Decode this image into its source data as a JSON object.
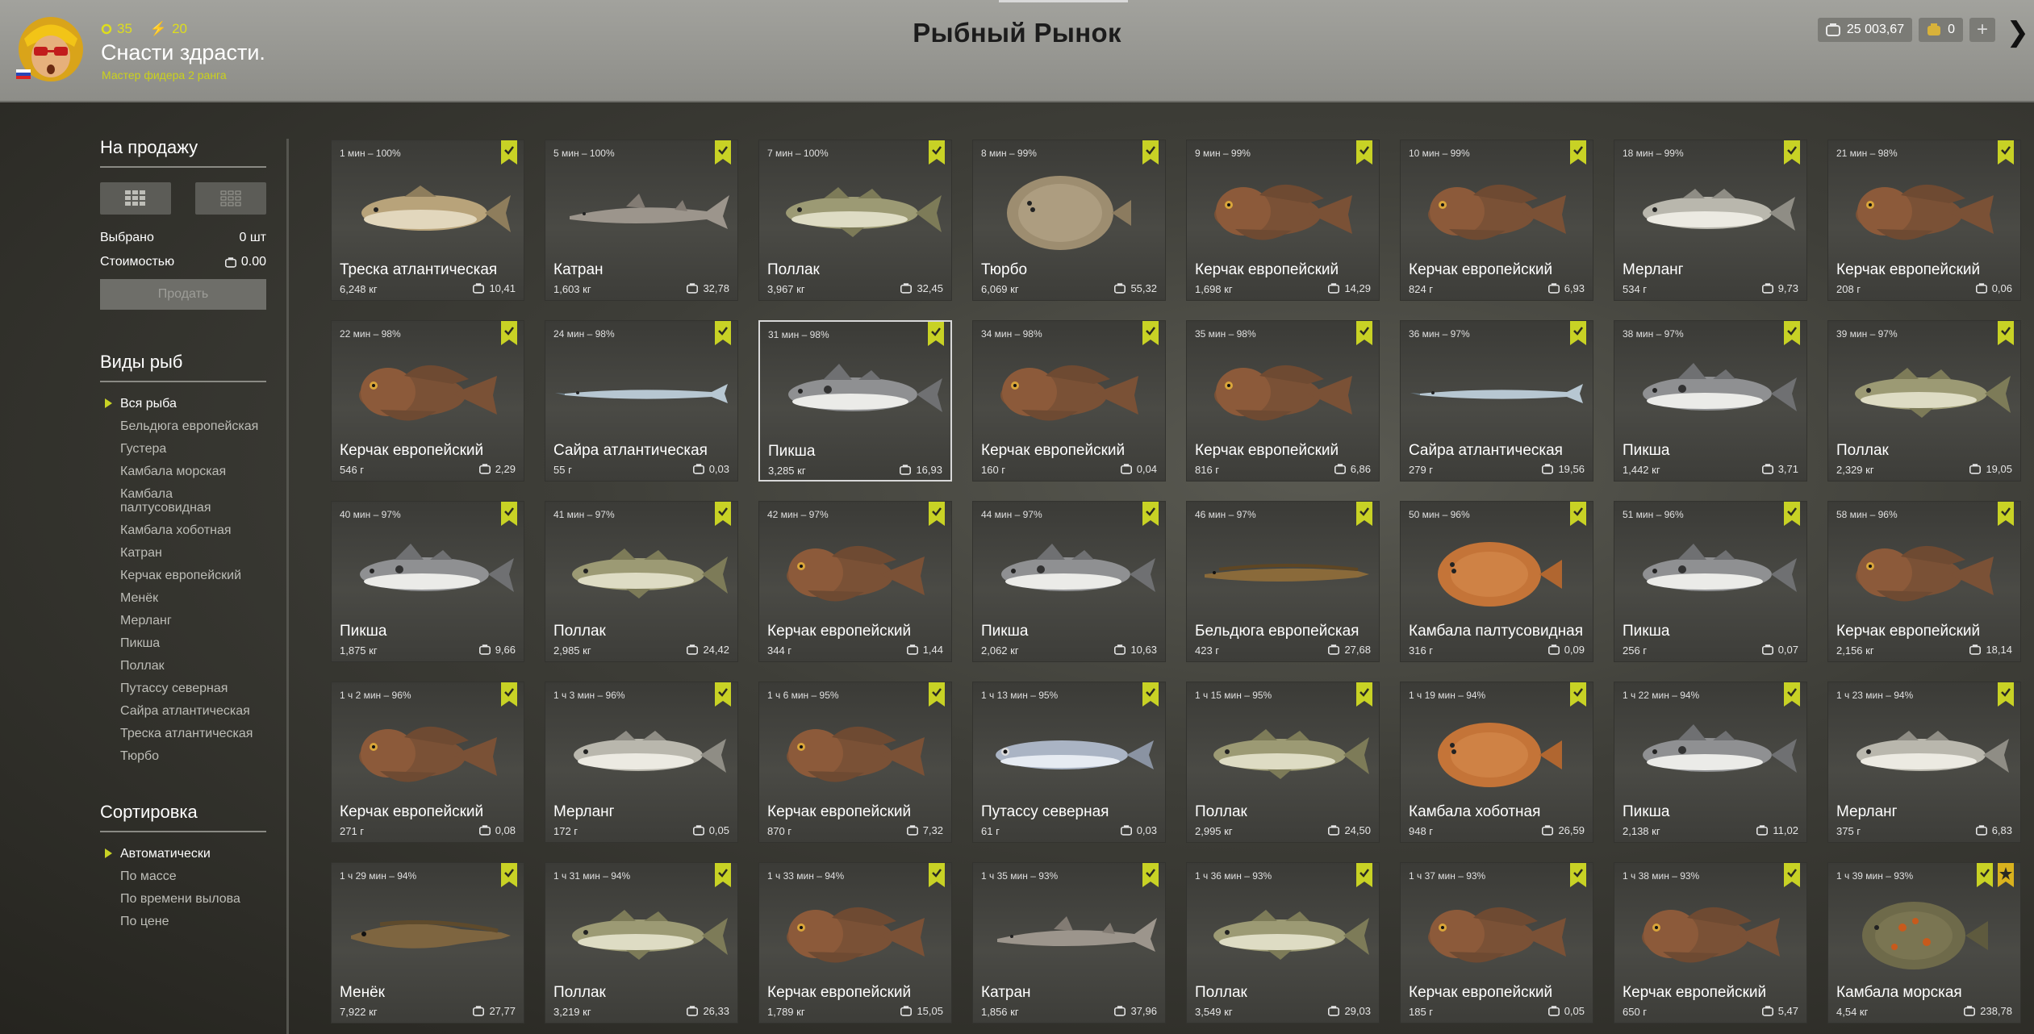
{
  "header": {
    "title": "Рыбный Рынок",
    "player_name": "Снасти здрасти.",
    "player_rank": "Мастер фидера 2 ранга",
    "level": "35",
    "stars": "20",
    "money": "25 003,67",
    "gold": "0",
    "plus": "+",
    "close": "❯"
  },
  "sidebar": {
    "sale_title": "На продажу",
    "selected_label": "Выбрано",
    "selected_value": "0 шт",
    "cost_label": "Стоимостью",
    "cost_value": "0.00",
    "sell_button": "Продать",
    "species_title": "Виды рыб",
    "species": [
      "Вся рыба",
      "Бельдюга европейская",
      "Густера",
      "Камбала морская",
      "Камбала палтусовидная",
      "Камбала хоботная",
      "Катран",
      "Керчак европейский",
      "Менёк",
      "Мерланг",
      "Пикша",
      "Поллак",
      "Путассу северная",
      "Сайра атлантическая",
      "Треска атлантическая",
      "Тюрбо"
    ],
    "sort_title": "Сортировка",
    "sort_options": [
      "Автоматически",
      "По массе",
      "По времени вылова",
      "По цене"
    ]
  },
  "colors": {
    "accent_lime": "#c8d225",
    "header_bg": "#9a9a95",
    "card_bg": "#42423d"
  },
  "fish": [
    {
      "time": "1 мин – 100%",
      "name": "Треска атлантическая",
      "weight": "6,248 кг",
      "price": "10,41",
      "kind": "cod",
      "badge": "check"
    },
    {
      "time": "5 мин – 100%",
      "name": "Катран",
      "weight": "1,603 кг",
      "price": "32,78",
      "kind": "shark",
      "badge": "check"
    },
    {
      "time": "7 мин – 100%",
      "name": "Поллак",
      "weight": "3,967 кг",
      "price": "32,45",
      "kind": "pollock",
      "badge": "check"
    },
    {
      "time": "8 мин – 99%",
      "name": "Тюрбо",
      "weight": "6,069 кг",
      "price": "55,32",
      "kind": "turbot",
      "badge": "check"
    },
    {
      "time": "9 мин – 99%",
      "name": "Керчак европейский",
      "weight": "1,698 кг",
      "price": "14,29",
      "kind": "sculpin",
      "badge": "check"
    },
    {
      "time": "10 мин – 99%",
      "name": "Керчак европейский",
      "weight": "824 г",
      "price": "6,93",
      "kind": "sculpin",
      "badge": "check"
    },
    {
      "time": "18 мин – 99%",
      "name": "Мерланг",
      "weight": "534 г",
      "price": "9,73",
      "kind": "whiting",
      "badge": "check"
    },
    {
      "time": "21 мин – 98%",
      "name": "Керчак европейский",
      "weight": "208 г",
      "price": "0,06",
      "kind": "sculpin",
      "badge": "check"
    },
    {
      "time": "22 мин – 98%",
      "name": "Керчак европейский",
      "weight": "546 г",
      "price": "2,29",
      "kind": "sculpin",
      "badge": "check"
    },
    {
      "time": "24 мин – 98%",
      "name": "Сайра атлантическая",
      "weight": "55 г",
      "price": "0,03",
      "kind": "saury",
      "badge": "check"
    },
    {
      "time": "31 мин – 98%",
      "name": "Пикша",
      "weight": "3,285 кг",
      "price": "16,93",
      "kind": "haddock",
      "badge": "check",
      "selected": true
    },
    {
      "time": "34 мин – 98%",
      "name": "Керчак европейский",
      "weight": "160 г",
      "price": "0,04",
      "kind": "sculpin",
      "badge": "check"
    },
    {
      "time": "35 мин – 98%",
      "name": "Керчак европейский",
      "weight": "816 г",
      "price": "6,86",
      "kind": "sculpin",
      "badge": "check"
    },
    {
      "time": "36 мин – 97%",
      "name": "Сайра атлантическая",
      "weight": "279 г",
      "price": "19,56",
      "kind": "saury",
      "badge": "check"
    },
    {
      "time": "38 мин – 97%",
      "name": "Пикша",
      "weight": "1,442 кг",
      "price": "3,71",
      "kind": "haddock",
      "badge": "check"
    },
    {
      "time": "39 мин – 97%",
      "name": "Поллак",
      "weight": "2,329 кг",
      "price": "19,05",
      "kind": "pollock",
      "badge": "check"
    },
    {
      "time": "40 мин – 97%",
      "name": "Пикша",
      "weight": "1,875 кг",
      "price": "9,66",
      "kind": "haddock",
      "badge": "check"
    },
    {
      "time": "41 мин – 97%",
      "name": "Поллак",
      "weight": "2,985 кг",
      "price": "24,42",
      "kind": "pollock",
      "badge": "check"
    },
    {
      "time": "42 мин – 97%",
      "name": "Керчак европейский",
      "weight": "344 г",
      "price": "1,44",
      "kind": "sculpin",
      "badge": "check"
    },
    {
      "time": "44 мин – 97%",
      "name": "Пикша",
      "weight": "2,062 кг",
      "price": "10,63",
      "kind": "haddock",
      "badge": "check"
    },
    {
      "time": "46 мин – 97%",
      "name": "Бельдюга европейская",
      "weight": "423 г",
      "price": "27,68",
      "kind": "eelpout",
      "badge": "check"
    },
    {
      "time": "50 мин – 96%",
      "name": "Камбала палтусовидная",
      "weight": "316 г",
      "price": "0,09",
      "kind": "flounder",
      "badge": "check"
    },
    {
      "time": "51 мин – 96%",
      "name": "Пикша",
      "weight": "256 г",
      "price": "0,07",
      "kind": "haddock",
      "badge": "check"
    },
    {
      "time": "58 мин – 96%",
      "name": "Керчак европейский",
      "weight": "2,156 кг",
      "price": "18,14",
      "kind": "sculpin",
      "badge": "check"
    },
    {
      "time": "1 ч 2 мин – 96%",
      "name": "Керчак европейский",
      "weight": "271 г",
      "price": "0,08",
      "kind": "sculpin",
      "badge": "check"
    },
    {
      "time": "1 ч 3 мин – 96%",
      "name": "Мерланг",
      "weight": "172 г",
      "price": "0,05",
      "kind": "whiting",
      "badge": "check"
    },
    {
      "time": "1 ч 6 мин – 95%",
      "name": "Керчак европейский",
      "weight": "870 г",
      "price": "7,32",
      "kind": "sculpin",
      "badge": "check"
    },
    {
      "time": "1 ч 13 мин – 95%",
      "name": "Путассу северная",
      "weight": "61 г",
      "price": "0,03",
      "kind": "blue_whiting",
      "badge": "check"
    },
    {
      "time": "1 ч 15 мин – 95%",
      "name": "Поллак",
      "weight": "2,995 кг",
      "price": "24,50",
      "kind": "pollock",
      "badge": "check"
    },
    {
      "time": "1 ч 19 мин – 94%",
      "name": "Камбала хоботная",
      "weight": "948 г",
      "price": "26,59",
      "kind": "flounder",
      "badge": "check"
    },
    {
      "time": "1 ч 22 мин – 94%",
      "name": "Пикша",
      "weight": "2,138 кг",
      "price": "11,02",
      "kind": "haddock",
      "badge": "check"
    },
    {
      "time": "1 ч 23 мин – 94%",
      "name": "Мерланг",
      "weight": "375 г",
      "price": "6,83",
      "kind": "whiting",
      "badge": "check"
    },
    {
      "time": "1 ч 29 мин – 94%",
      "name": "Менёк",
      "weight": "7,922 кг",
      "price": "27,77",
      "kind": "tusk",
      "badge": "check"
    },
    {
      "time": "1 ч 31 мин – 94%",
      "name": "Поллак",
      "weight": "3,219 кг",
      "price": "26,33",
      "kind": "pollock",
      "badge": "check"
    },
    {
      "time": "1 ч 33 мин – 94%",
      "name": "Керчак европейский",
      "weight": "1,789 кг",
      "price": "15,05",
      "kind": "sculpin",
      "badge": "check"
    },
    {
      "time": "1 ч 35 мин – 93%",
      "name": "Катран",
      "weight": "1,856 кг",
      "price": "37,96",
      "kind": "shark",
      "badge": "check"
    },
    {
      "time": "1 ч 36 мин – 93%",
      "name": "Поллак",
      "weight": "3,549 кг",
      "price": "29,03",
      "kind": "pollock",
      "badge": "check"
    },
    {
      "time": "1 ч 37 мин – 93%",
      "name": "Керчак европейский",
      "weight": "185 г",
      "price": "0,05",
      "kind": "sculpin",
      "badge": "check"
    },
    {
      "time": "1 ч 38 мин – 93%",
      "name": "Керчак европейский",
      "weight": "650 г",
      "price": "5,47",
      "kind": "sculpin",
      "badge": "check"
    },
    {
      "time": "1 ч 39 мин – 93%",
      "name": "Камбала морская",
      "weight": "4,54 кг",
      "price": "238,78",
      "kind": "plaice",
      "badge": "check",
      "star": true
    }
  ]
}
